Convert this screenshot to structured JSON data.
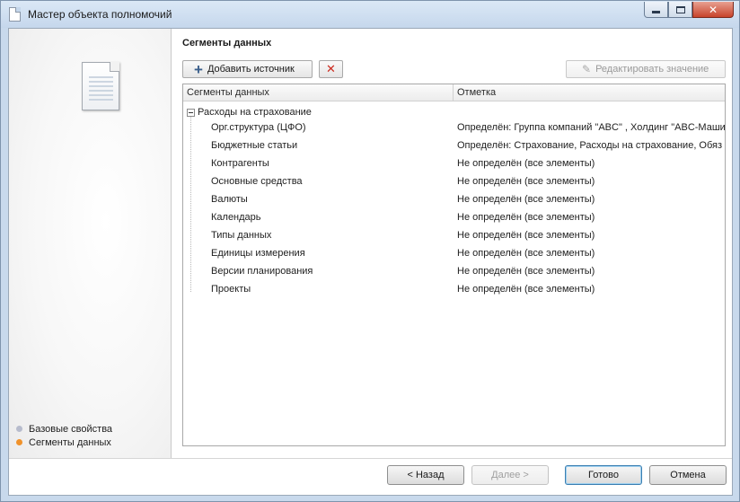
{
  "window": {
    "title": "Мастер объекта полномочий",
    "controls": {
      "minimize": "minimize-icon",
      "maximize": "maximize-icon",
      "close": "✕"
    }
  },
  "sidebar": {
    "steps": [
      {
        "label": "Базовые свойства",
        "state": "inactive",
        "color": "#b7bccd"
      },
      {
        "label": "Сегменты данных",
        "state": "active",
        "color": "#f0922b"
      }
    ]
  },
  "main": {
    "section_title": "Сегменты данных",
    "toolbar": {
      "add_label": "Добавить источник",
      "delete_icon": "delete-icon",
      "edit_label": "Редактировать значение"
    },
    "grid": {
      "columns": [
        "Сегменты данных",
        "Отметка"
      ],
      "group": "Расходы на страхование",
      "rows": [
        {
          "name": "Орг.структура (ЦФО)",
          "mark": "Определён: Группа компаний \"ABC\" , Холдинг \"ABC-Машин"
        },
        {
          "name": "Бюджетные статьи",
          "mark": "Определён: Страхование, Расходы на страхование, Обяз"
        },
        {
          "name": "Контрагенты",
          "mark": "Не определён (все элементы)"
        },
        {
          "name": "Основные средства",
          "mark": "Не определён (все элементы)"
        },
        {
          "name": "Валюты",
          "mark": "Не определён (все элементы)"
        },
        {
          "name": "Календарь",
          "mark": "Не определён (все элементы)"
        },
        {
          "name": "Типы данных",
          "mark": "Не определён (все элементы)"
        },
        {
          "name": "Единицы измерения",
          "mark": "Не определён (все элементы)"
        },
        {
          "name": "Версии планирования",
          "mark": "Не определён (все элементы)"
        },
        {
          "name": "Проекты",
          "mark": "Не определён (все элементы)"
        }
      ]
    }
  },
  "footer": {
    "back_label": "< Назад",
    "next_label": "Далее >",
    "done_label": "Готово",
    "cancel_label": "Отмена"
  }
}
